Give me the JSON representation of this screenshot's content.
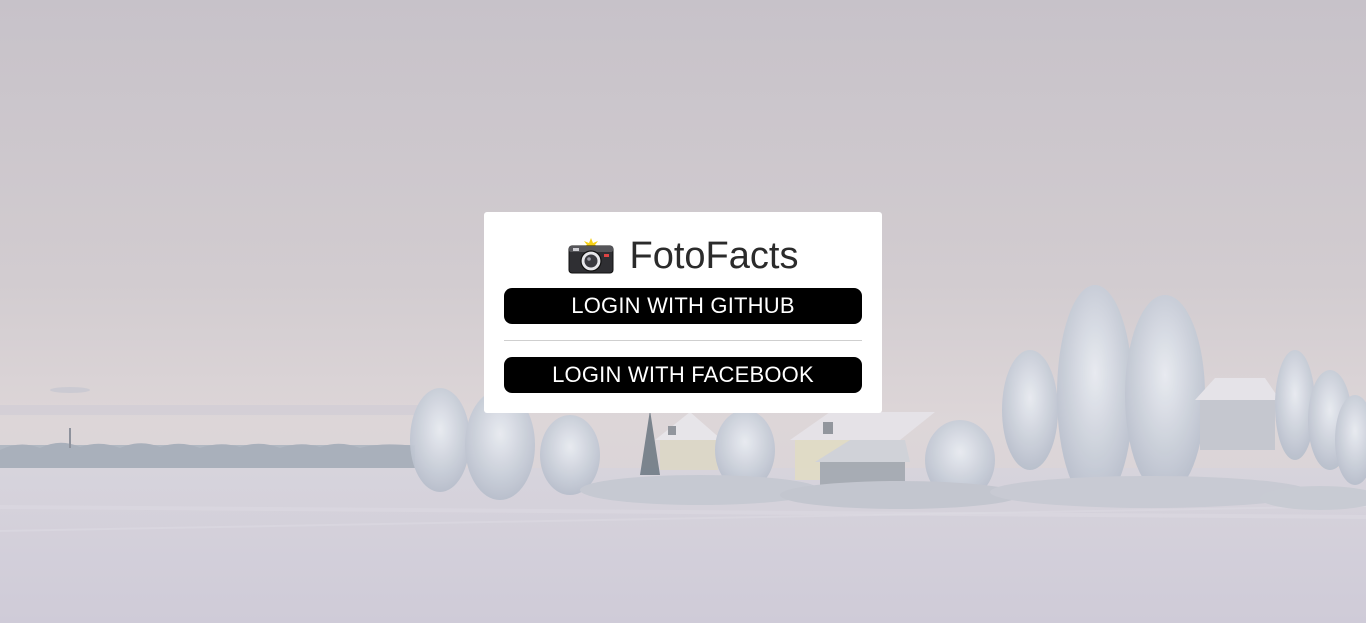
{
  "app": {
    "name": "FotoFacts",
    "logo_icon": "camera-flash-icon"
  },
  "login": {
    "github_label": "LOGIN WITH GITHUB",
    "facebook_label": "LOGIN WITH FACEBOOK"
  },
  "colors": {
    "button_bg": "#000000",
    "button_text": "#ffffff",
    "card_bg": "#ffffff",
    "sky": "#cbc6cc",
    "snow": "#d8d5de"
  }
}
